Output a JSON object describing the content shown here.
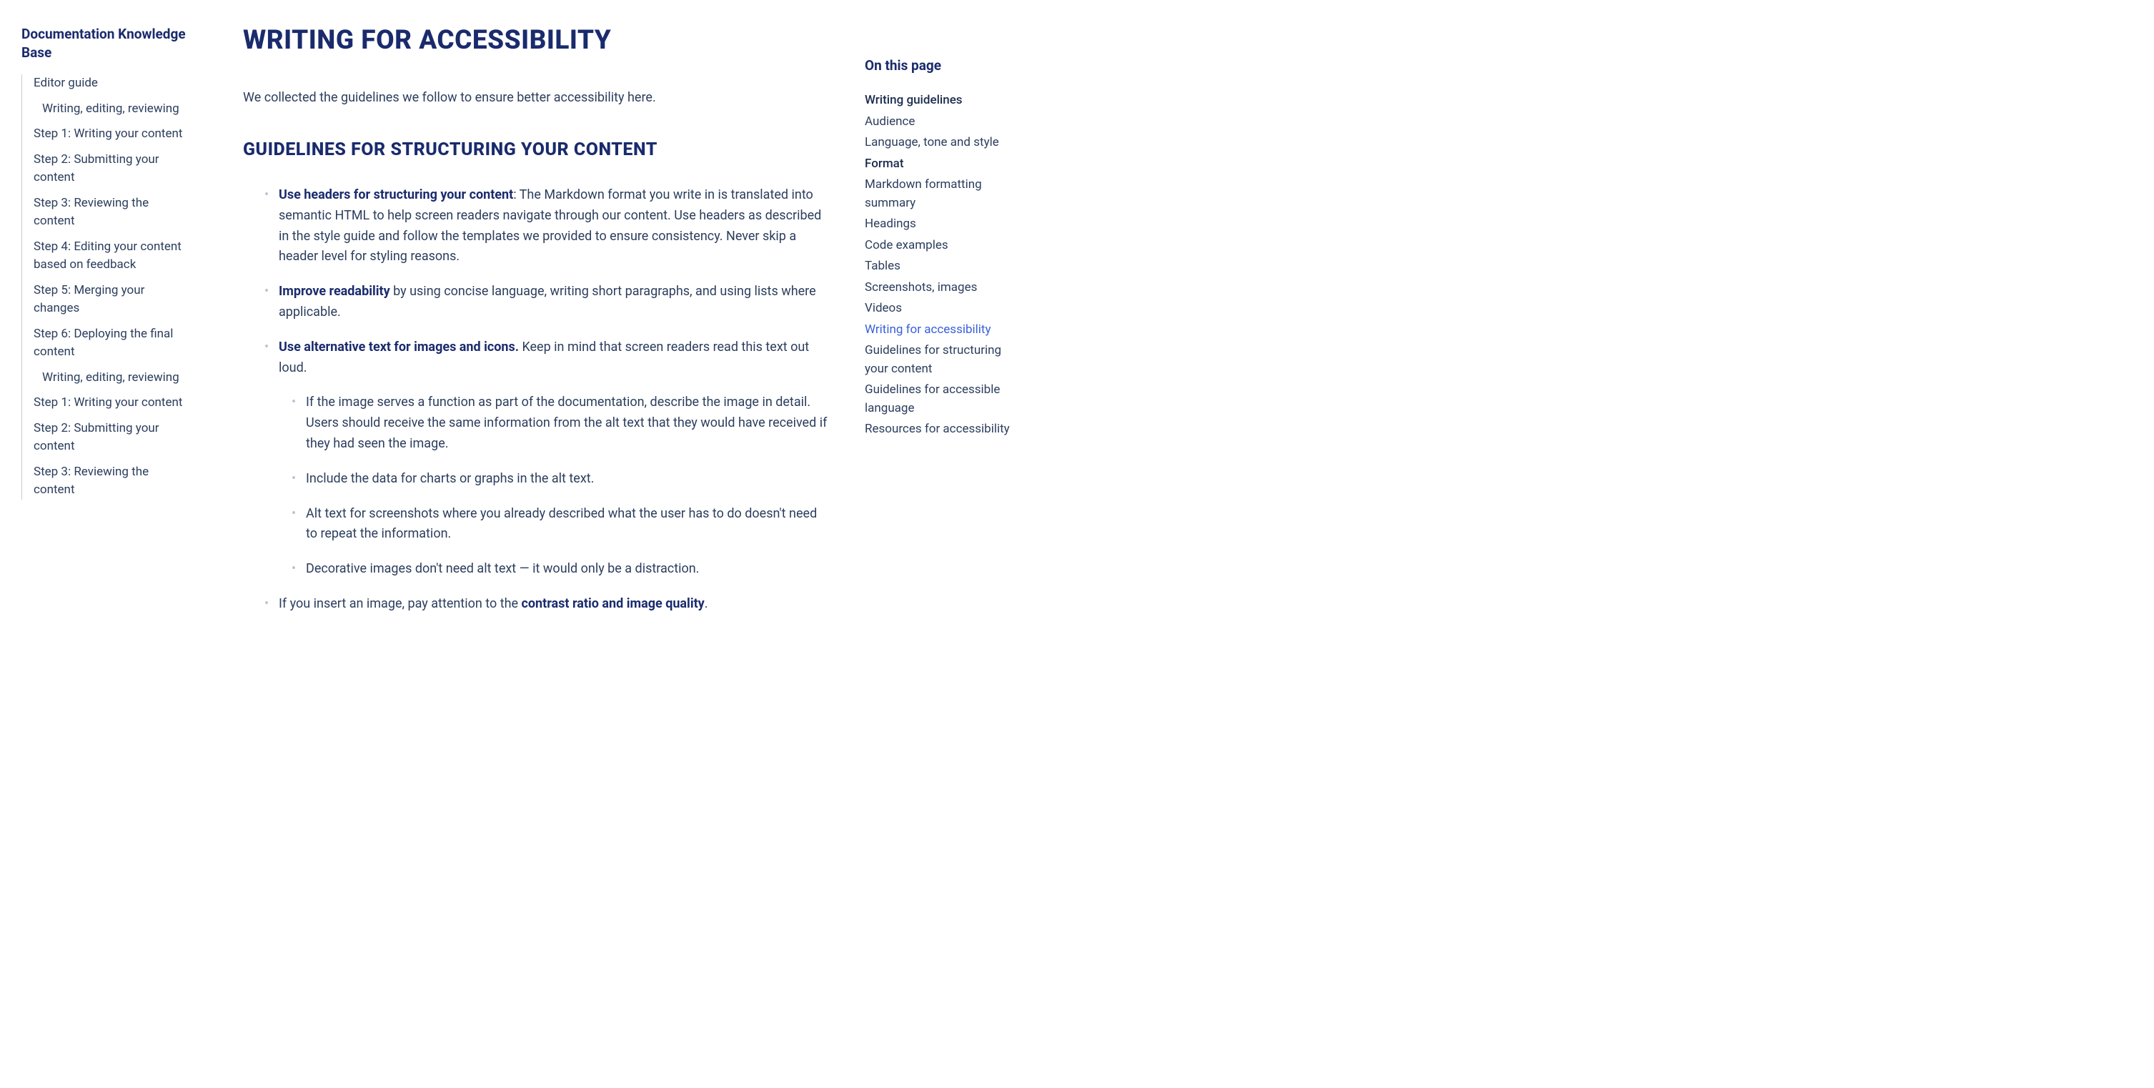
{
  "sidebar": {
    "title": "Documentation Knowledge Base",
    "items": [
      {
        "label": "Editor guide",
        "sub": false
      },
      {
        "label": "Writing, editing, reviewing",
        "sub": true
      },
      {
        "label": "Step 1: Writing your content",
        "sub": false
      },
      {
        "label": "Step 2: Submitting your content",
        "sub": false
      },
      {
        "label": "Step 3: Reviewing the content",
        "sub": false
      },
      {
        "label": "Step 4: Editing your content based on feedback",
        "sub": false
      },
      {
        "label": "Step 5: Merging your changes",
        "sub": false
      },
      {
        "label": "Step 6: Deploying the final content",
        "sub": false
      },
      {
        "label": "Writing, editing, reviewing",
        "sub": true
      },
      {
        "label": "Step 1: Writing your content",
        "sub": false
      },
      {
        "label": "Step 2: Submitting your content",
        "sub": false
      },
      {
        "label": "Step 3: Reviewing the content",
        "sub": false
      }
    ]
  },
  "main": {
    "title": "WRITING FOR ACCESSIBILITY",
    "intro": "We collected the guidelines we follow to ensure better accessibility here.",
    "h2": "GUIDELINES FOR STRUCTURING YOUR CONTENT",
    "items": {
      "item1_bold": "Use headers for structuring your content",
      "item1_text": ": The Markdown format you write in is translated into semantic HTML to help screen readers navigate through our content. Use headers as described in the style guide and follow the templates we provided to ensure consistency. Never skip a header level for styling reasons.",
      "item2_bold": "Improve readability",
      "item2_text": " by using concise language, writing short paragraphs, and using lists where applicable.",
      "item3_bold": "Use alternative text for images and icons.",
      "item3_text": " Keep in mind that screen readers read this text out loud.",
      "sub1": "If the image serves a function as part of the documentation, describe the image in detail. Users should receive the same information from the alt text that they would have received if they had seen the image.",
      "sub2": "Include the data for charts or graphs in the alt text.",
      "sub3": "Alt text for screenshots where you already described what the user has to do doesn't need to repeat the information.",
      "sub4": "Decorative images don't need alt text — it would only be a distraction.",
      "item4_text": "If you insert an image, pay attention to the ",
      "item4_bold": "contrast ratio and image quality",
      "item4_end": "."
    }
  },
  "toc": {
    "title": "On this page",
    "items": [
      {
        "label": "Writing guidelines",
        "section": true,
        "active": false
      },
      {
        "label": "Audience",
        "section": false,
        "active": false
      },
      {
        "label": "Language, tone and style",
        "section": false,
        "active": false
      },
      {
        "label": "Format",
        "section": true,
        "active": false
      },
      {
        "label": "Markdown formatting summary",
        "section": false,
        "active": false
      },
      {
        "label": "Headings",
        "section": false,
        "active": false
      },
      {
        "label": "Code examples",
        "section": false,
        "active": false
      },
      {
        "label": "Tables",
        "section": false,
        "active": false
      },
      {
        "label": "Screenshots, images",
        "section": false,
        "active": false
      },
      {
        "label": "Videos",
        "section": false,
        "active": false
      },
      {
        "label": "Writing for accessibility",
        "section": false,
        "active": true
      },
      {
        "label": "Guidelines for structuring your content",
        "section": false,
        "active": false
      },
      {
        "label": "Guidelines for accessible language",
        "section": false,
        "active": false
      },
      {
        "label": "Resources for accessibility",
        "section": false,
        "active": false
      }
    ]
  }
}
